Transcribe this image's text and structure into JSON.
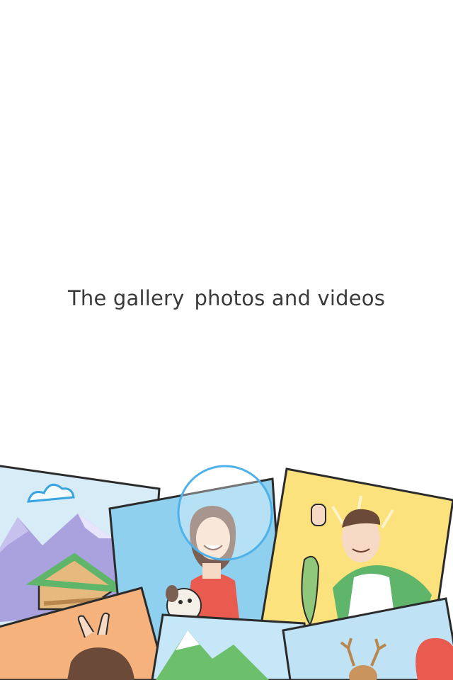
{
  "onboarding": {
    "caption_part1": "The gallery",
    "caption_part2": "photos and videos"
  },
  "colors": {
    "background": "#ffffff",
    "text": "#3a3a3a",
    "accent_circle": "#4fb1ea",
    "card_outline": "#2b2b2b"
  },
  "illustration": {
    "cards": [
      {
        "name": "mountain-card",
        "subject": "mountains-and-cabin"
      },
      {
        "name": "woman-card",
        "subject": "smiling-woman-with-dog"
      },
      {
        "name": "fisherman-card",
        "subject": "man-holding-fish"
      },
      {
        "name": "boy-card",
        "subject": "person-with-bunny-ears"
      },
      {
        "name": "landscape-card",
        "subject": "green-mountains"
      },
      {
        "name": "deer-card",
        "subject": "deer"
      }
    ],
    "highlight_icon": "face-focus-circle"
  }
}
